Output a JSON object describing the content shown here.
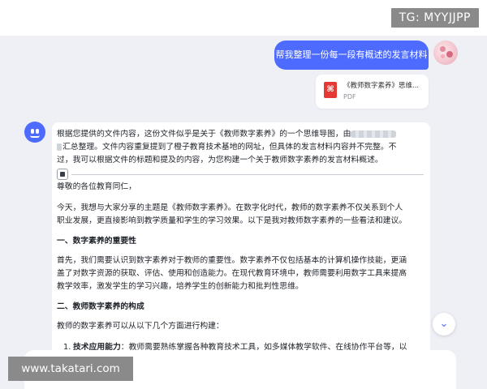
{
  "watermarks": {
    "top_right": "TG: MYYJJPP",
    "bottom_left": "www.takatari.com"
  },
  "user_message": {
    "text": "帮我整理一份每一段有概述的发言材料"
  },
  "attachment": {
    "name": "《教师数字素养》思维...",
    "type": "PDF",
    "icon_color": "#e53935"
  },
  "answer": {
    "intro_line1_start": "根据您提供的文件内容，这份文件似乎是关于《教师数字素养》的一个思维导图，由",
    "intro_line2_end": "汇总整理。文件内容重复提到了橙子教育技术基地的网址，但具体的发言材料内容并不完整。不",
    "intro_line3": "过，我可以根据文件的标题和提及的内容，为您构建一个关于教师数字素养的发言材料概述。",
    "greeting": "尊敬的各位教育同仁，",
    "p1_line1": "今天，我想与大家分享的主题是《教师数字素养》。在数字化时代，教师的数字素养不仅关系到个人",
    "p1_line2": "职业发展，更直接影响到教学质量和学生的学习效果。以下是我对教师数字素养的一些看法和建议。",
    "h1": "一、数字素养的重要性",
    "p2_line1": "首先，我们需要认识到数字素养对于教师的重要性。数字素养不仅包括基本的计算机操作技能，更涵",
    "p2_line2": "盖了对数字资源的获取、评估、使用和创造能力。在现代教育环境中，教师需要利用数字工具来提高",
    "p2_line3": "教学效率，激发学生的学习兴趣，培养学生的创新能力和批判性思维。",
    "h2": "二、教师数字素养的构成",
    "p3": "教师的数字素养可以从以下几个方面进行构建：",
    "li1_num": "1.",
    "li1_bold": "技术应用能力",
    "li1_text": "：教师需要熟练掌握各种教育技术工具，如多媒体教学软件、在线协作平台等，以"
  },
  "colors": {
    "accent": "#4d6bfe",
    "page_bg": "#eef0f6"
  }
}
